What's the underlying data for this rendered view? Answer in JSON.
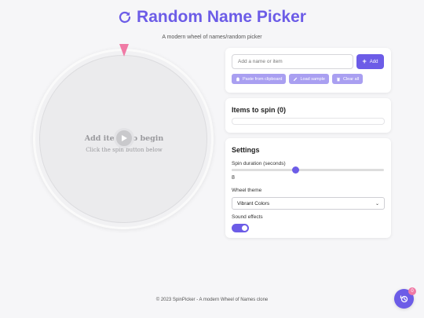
{
  "header": {
    "title": "Random Name Picker",
    "subtitle": "A modern wheel of names/random picker",
    "icon": "refresh-icon"
  },
  "wheel": {
    "empty_title": "Add items to begin",
    "empty_hint": "Click the spin button below",
    "pointer_color": "#f07aa5",
    "spin_icon": "play-icon"
  },
  "input_panel": {
    "placeholder": "Add a name or item",
    "add_label": "Add",
    "paste_label": "Paste from clipboard",
    "sample_label": "Load sample",
    "clear_label": "Clear all"
  },
  "items_panel": {
    "title": "Items to spin (0)"
  },
  "settings": {
    "title": "Settings",
    "duration_label": "Spin duration (seconds)",
    "duration_value": "8",
    "duration_fraction": 0.42,
    "theme_label": "Wheel theme",
    "theme_value": "Vibrant Colors",
    "sound_label": "Sound effects",
    "sound_on": true
  },
  "footer": {
    "text": "© 2023 SpinPicker - A modern Wheel of Names clone"
  },
  "history": {
    "badge": "0",
    "icon": "history-icon"
  },
  "colors": {
    "accent": "#6c5ce7",
    "accent_light": "#a99ff1",
    "pink": "#f07aa5"
  }
}
